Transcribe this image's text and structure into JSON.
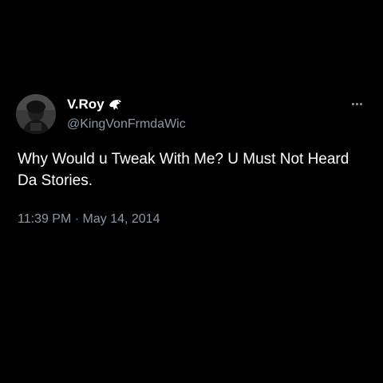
{
  "tweet": {
    "author": {
      "display_name": "V.Roy",
      "badge_icon": "eagle-icon",
      "handle": "@KingVonFrmdaWic",
      "avatar_icon": "avatar"
    },
    "more_icon": "more-dots-icon",
    "text": "Why Would u Tweak With Me? U Must Not Heard Da Stories.",
    "timestamp": "11:39 PM · May 14, 2014"
  },
  "colors": {
    "background": "#000000",
    "primary_text": "#ffffff",
    "secondary_text": "#8b98a5"
  }
}
